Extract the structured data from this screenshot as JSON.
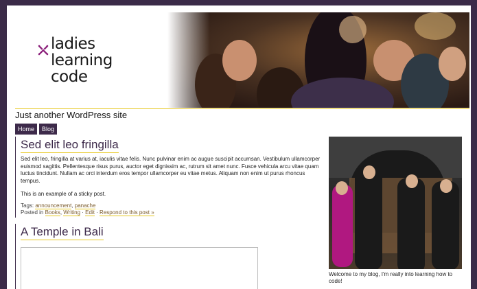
{
  "site": {
    "logo_lines": [
      "ladies",
      "learning",
      "code"
    ],
    "tagline": "Just another WordPress site",
    "accent_color": "#e6c619",
    "brand_color": "#3d2a4a",
    "logo_mark_color": "#8b1f7a"
  },
  "nav": {
    "items": [
      {
        "label": "Home"
      },
      {
        "label": "Blog"
      }
    ]
  },
  "posts": [
    {
      "title": "Sed elit leo fringilla",
      "body": "Sed elit leo, fringilla at varius at, iaculis vitae felis. Nunc pulvinar enim ac augue suscipit accumsan. Vestibulum ullamcorper euismod sagittis. Pellentesque risus purus, auctor eget dignissim ac, rutrum sit amet nunc. Fusce vehicula arcu vitae quam luctus tincidunt. Nullam ac orci interdum eros tempor ullamcorper eu vitae metus. Aliquam non enim ut purus rhoncus tempus.",
      "sticky_note": "This is an example of a sticky post.",
      "tags_label": "Tags:",
      "tags": [
        "announcement",
        "panache"
      ],
      "posted_in_label": "Posted in",
      "categories": [
        "Books",
        "Writing"
      ],
      "edit_label": "Edit",
      "respond_label": "Respond to this post »"
    },
    {
      "title": "A Temple in Bali"
    }
  ],
  "sidebar": {
    "caption": "Welcome to my blog, I'm really into learning how to code!"
  }
}
